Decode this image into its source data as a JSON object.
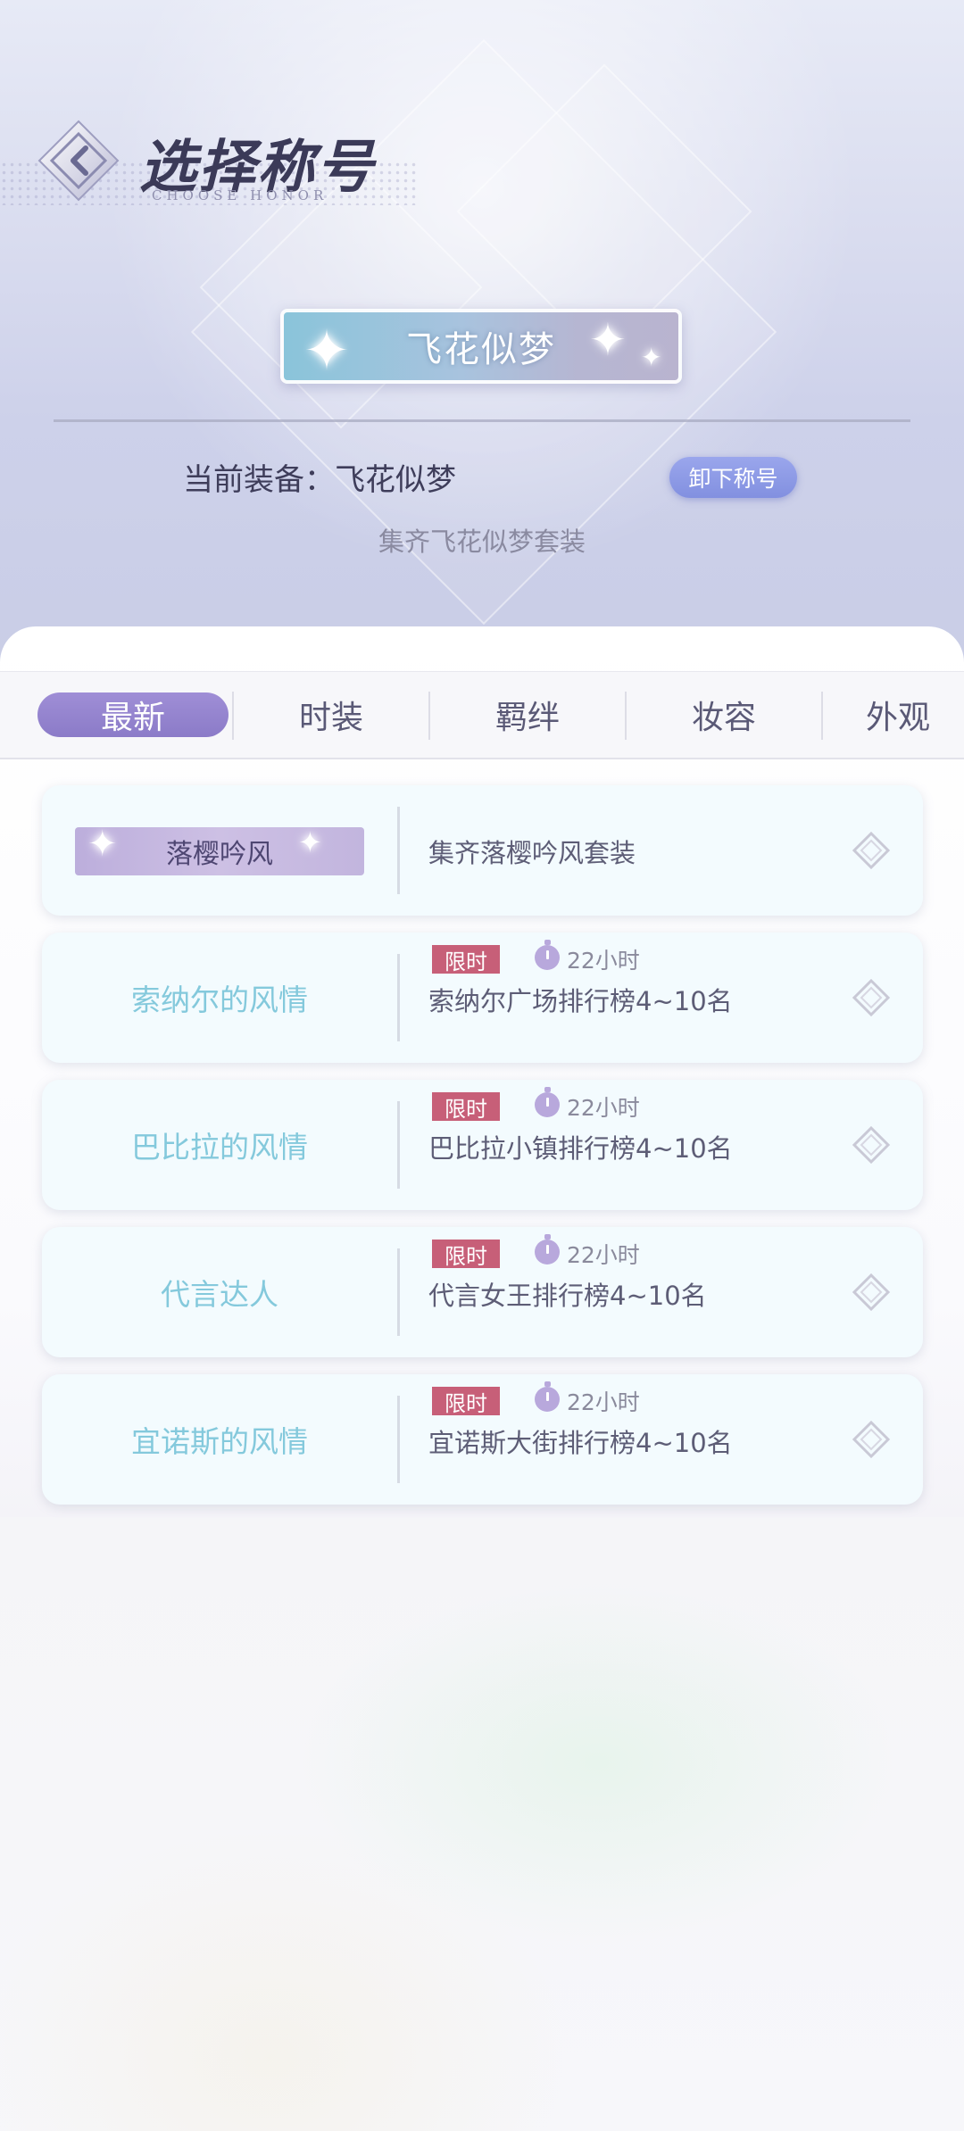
{
  "header": {
    "title": "选择称号",
    "subtitle": "CHOOSE HONOR"
  },
  "current": {
    "badge_text": "飞花似梦",
    "equip_text": "当前装备：飞花似梦",
    "unequip_label": "卸下称号",
    "condition": "集齐飞花似梦套装"
  },
  "tabs": [
    {
      "label": "最新",
      "active": true
    },
    {
      "label": "时装",
      "active": false
    },
    {
      "label": "羁绊",
      "active": false
    },
    {
      "label": "妆容",
      "active": false
    },
    {
      "label": "外观",
      "active": false
    }
  ],
  "honors": [
    {
      "name": "落樱吟风",
      "style": "badge",
      "limited": false,
      "desc": "集齐落樱吟风套装"
    },
    {
      "name": "索纳尔的风情",
      "style": "text",
      "limited": true,
      "limited_label": "限时",
      "time": "22小时",
      "desc": "索纳尔广场排行榜4~10名"
    },
    {
      "name": "巴比拉的风情",
      "style": "text",
      "limited": true,
      "limited_label": "限时",
      "time": "22小时",
      "desc": "巴比拉小镇排行榜4~10名"
    },
    {
      "name": "代言达人",
      "style": "text",
      "limited": true,
      "limited_label": "限时",
      "time": "22小时",
      "desc": "代言女王排行榜4~10名"
    },
    {
      "name": "宜诺斯的风情",
      "style": "text",
      "limited": true,
      "limited_label": "限时",
      "time": "22小时",
      "desc": "宜诺斯大街排行榜4~10名"
    }
  ],
  "icons": {
    "back": "back-arrow-icon",
    "timer": "timer-icon",
    "select": "diamond-select-icon"
  },
  "colors": {
    "accent": "#8b7bc8",
    "unequip": "#8290e0",
    "limited_tag": "#c75f78",
    "honor_text": "#84c9dc"
  }
}
